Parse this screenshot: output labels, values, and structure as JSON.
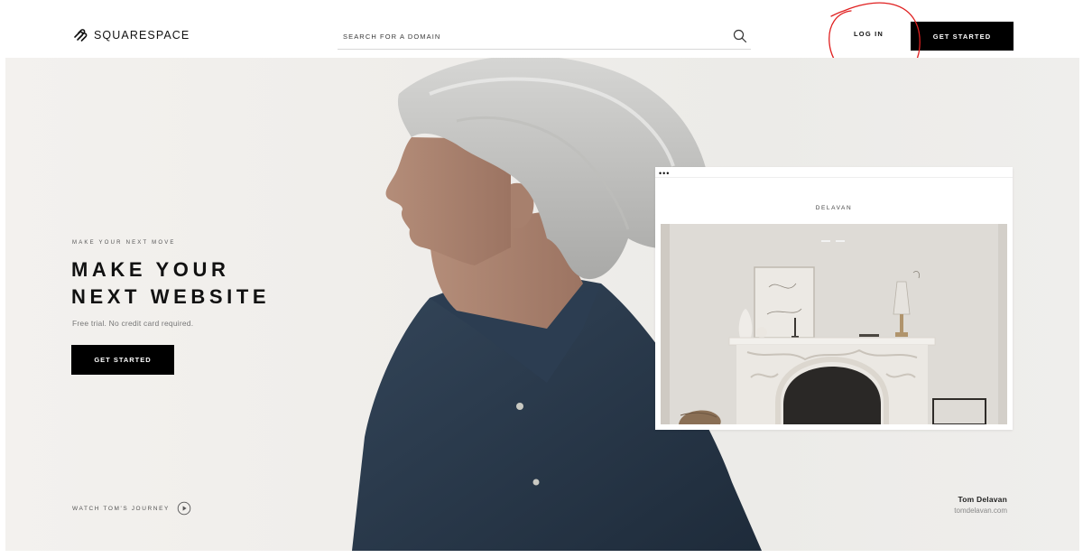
{
  "header": {
    "brand": "SQUARESPACE",
    "logo_icon": "squarespace-logo-icon",
    "search": {
      "placeholder": "SEARCH FOR A DOMAIN",
      "icon": "search-icon"
    },
    "login_label": "LOG IN",
    "cta_label": "GET STARTED"
  },
  "annotation": {
    "color": "#e02020",
    "shape": "hand-drawn-circle-around-login"
  },
  "hero": {
    "eyebrow": "MAKE YOUR NEXT MOVE",
    "headline": [
      "MAKE YOUR",
      "NEXT WEBSITE"
    ],
    "subline": "Free trial. No credit card required.",
    "cta_label": "GET STARTED",
    "watch_label": "WATCH TOM'S JOURNEY",
    "watch_icon": "play-circle-icon",
    "credit_name": "Tom Delavan",
    "credit_url": "tomdelavan.com"
  },
  "site_preview": {
    "window_dots": "•••",
    "site_title": "DELAVAN"
  },
  "colors": {
    "background": "#f1efec",
    "button": "#000000",
    "button_text": "#ffffff",
    "shirt": "#2b3a4c"
  }
}
